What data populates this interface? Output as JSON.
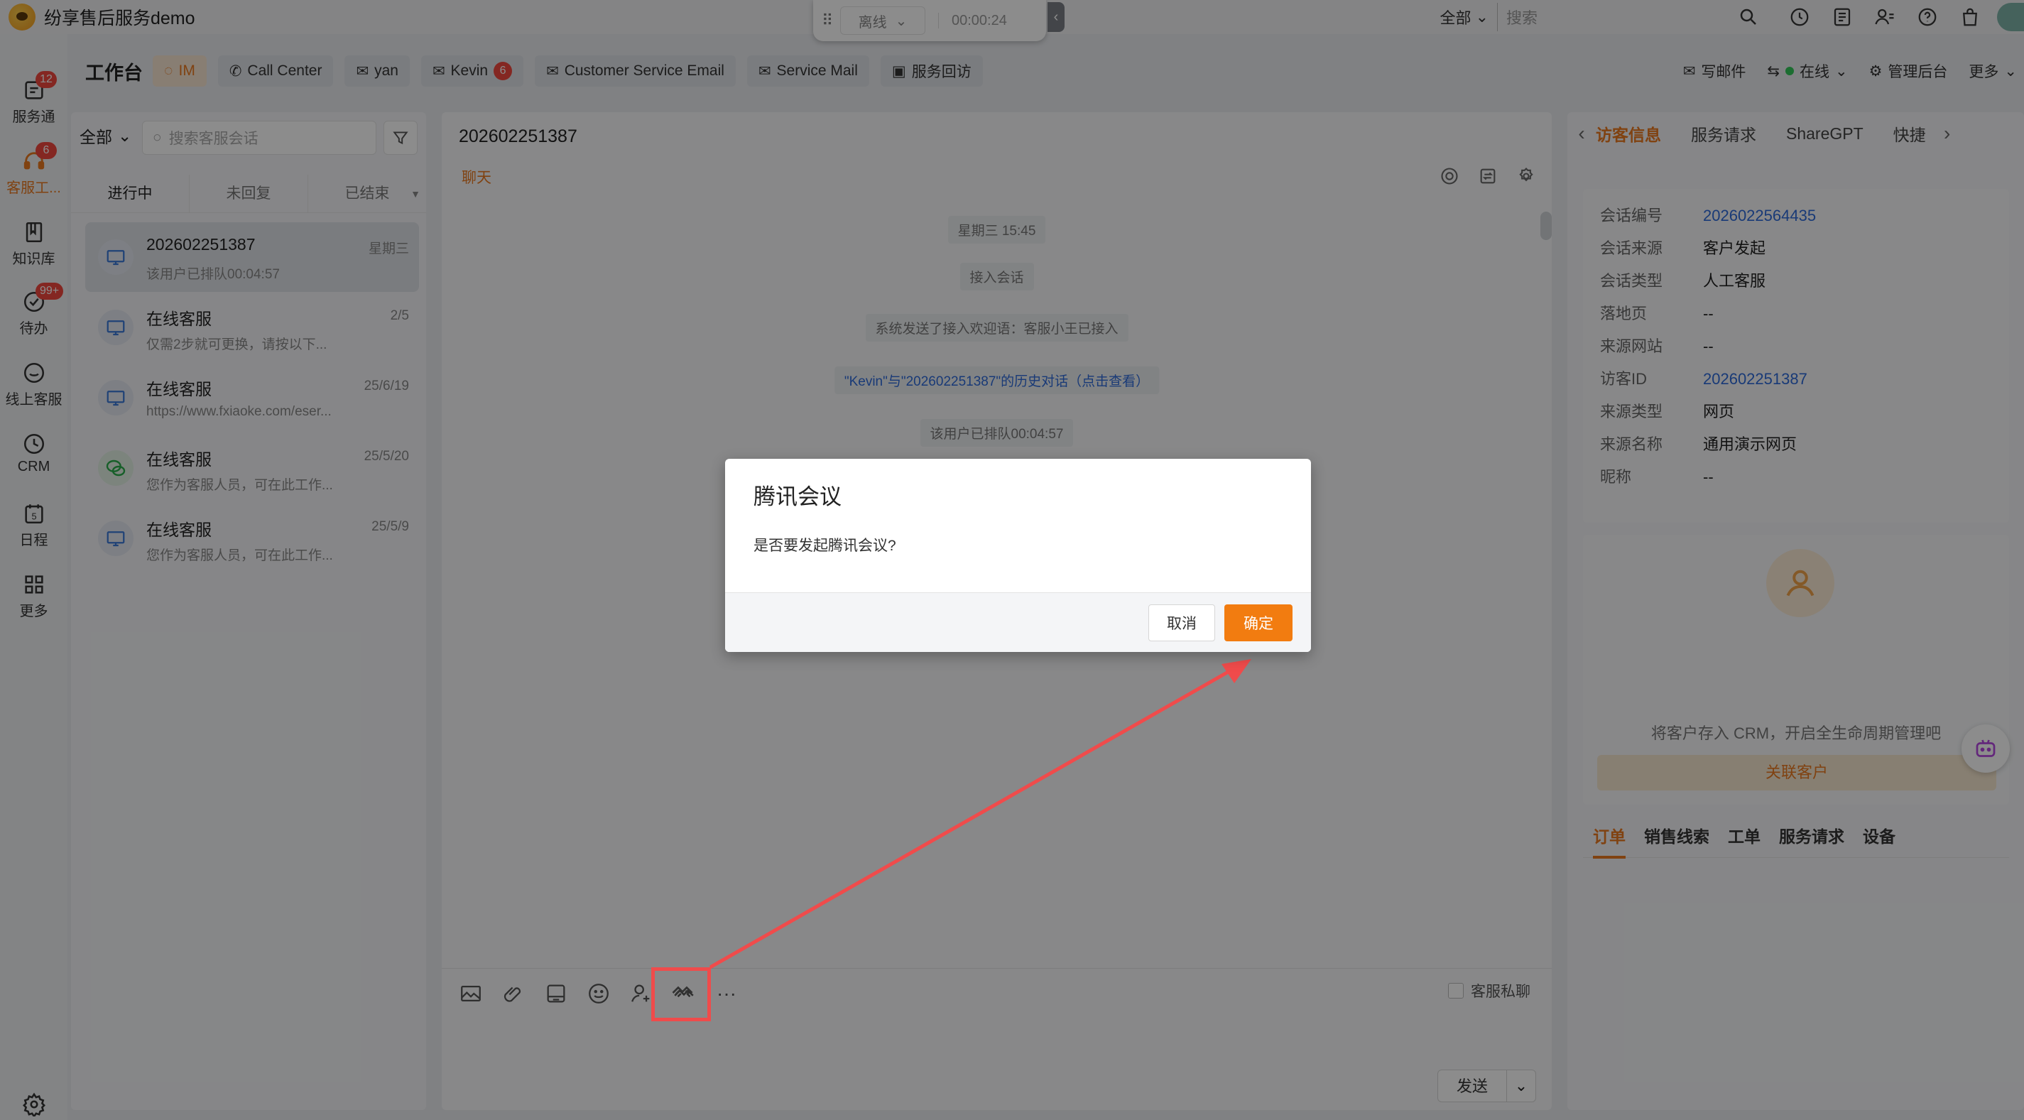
{
  "app": {
    "title": "纷享售后服务demo"
  },
  "topbar": {
    "scope": "全部",
    "search_placeholder": "搜索",
    "icons": [
      "clock-icon",
      "notes-icon",
      "contacts-icon",
      "help-icon",
      "bag-icon"
    ]
  },
  "call_widget": {
    "status": "离线",
    "timer": "00:00:24"
  },
  "leftnav": {
    "items": [
      {
        "label": "服务通",
        "badge": "12",
        "icon": "service-icon"
      },
      {
        "label": "客服工...",
        "badge": "6",
        "icon": "headset-icon",
        "active": true
      },
      {
        "label": "知识库",
        "badge": "",
        "icon": "book-icon"
      },
      {
        "label": "待办",
        "badge": "99+",
        "icon": "todo-icon"
      },
      {
        "label": "线上客服",
        "badge": "",
        "icon": "chat-service-icon"
      },
      {
        "label": "CRM",
        "badge": "",
        "icon": "crm-icon"
      },
      {
        "label": "日程",
        "badge": "",
        "icon": "calendar-icon"
      },
      {
        "label": "更多",
        "badge": "",
        "icon": "grid-icon"
      }
    ]
  },
  "tabbar": {
    "title": "工作台",
    "tabs": [
      {
        "label": "IM",
        "badge": ""
      },
      {
        "label": "Call Center",
        "badge": ""
      },
      {
        "label": "yan",
        "badge": ""
      },
      {
        "label": "Kevin",
        "badge": "6"
      },
      {
        "label": "Customer Service Email",
        "badge": ""
      },
      {
        "label": "Service Mail",
        "badge": ""
      },
      {
        "label": "服务回访",
        "badge": ""
      }
    ],
    "right": {
      "write_mail": "写邮件",
      "online": "在线",
      "admin": "管理后台",
      "more": "更多"
    }
  },
  "conversations": {
    "filter": "全部",
    "search_placeholder": "搜索客服会话",
    "subtabs": [
      "进行中",
      "未回复",
      "已结束"
    ],
    "items": [
      {
        "name": "202602251387",
        "time": "星期三",
        "preview": "该用户已排队00:04:57",
        "channel": "web"
      },
      {
        "name": "在线客服",
        "time": "2/5",
        "preview": "仅需2步就可更换，请按以下...",
        "channel": "web"
      },
      {
        "name": "在线客服",
        "time": "25/6/19",
        "preview": "https://www.fxiaoke.com/eser...",
        "channel": "web"
      },
      {
        "name": "在线客服",
        "time": "25/5/20",
        "preview": "您作为客服人员，可在此工作...",
        "channel": "wechat"
      },
      {
        "name": "在线客服",
        "time": "25/5/9",
        "preview": "您作为客服人员，可在此工作...",
        "channel": "web"
      }
    ]
  },
  "chat": {
    "title": "202602251387",
    "subtitle": "聊天",
    "messages": [
      "星期三 15:45",
      "接入会话",
      "系统发送了接入欢迎语：客服小王已接入",
      "\"Kevin\"与\"202602251387\"的历史对话（点击查看）",
      "该用户已排队00:04:57"
    ],
    "private_chat": "客服私聊",
    "send": "发送"
  },
  "rightpanel": {
    "tabs": [
      "访客信息",
      "服务请求",
      "ShareGPT",
      "快捷"
    ],
    "info": [
      {
        "k": "会话编号",
        "v": "2026022564435",
        "link": true
      },
      {
        "k": "会话来源",
        "v": "客户发起",
        "link": false
      },
      {
        "k": "会话类型",
        "v": "人工客服",
        "link": false
      },
      {
        "k": "落地页",
        "v": "--",
        "link": false
      },
      {
        "k": "来源网站",
        "v": "--",
        "link": false
      },
      {
        "k": "访客ID",
        "v": "202602251387",
        "link": true
      },
      {
        "k": "来源类型",
        "v": "网页",
        "link": false
      },
      {
        "k": "来源名称",
        "v": "通用演示网页",
        "link": false
      },
      {
        "k": "昵称",
        "v": "--",
        "link": false
      }
    ],
    "crm_text": "将客户存入 CRM，开启全生命周期管理吧",
    "crm_button": "关联客户",
    "bottom_tabs": [
      "订单",
      "销售线索",
      "工单",
      "服务请求",
      "设备"
    ]
  },
  "dialog": {
    "title": "腾讯会议",
    "body": "是否要发起腾讯会议?",
    "cancel": "取消",
    "confirm": "确定"
  },
  "colors": {
    "accent": "#f27c10",
    "link": "#2e6bd9",
    "annotation": "#f04b4b"
  }
}
